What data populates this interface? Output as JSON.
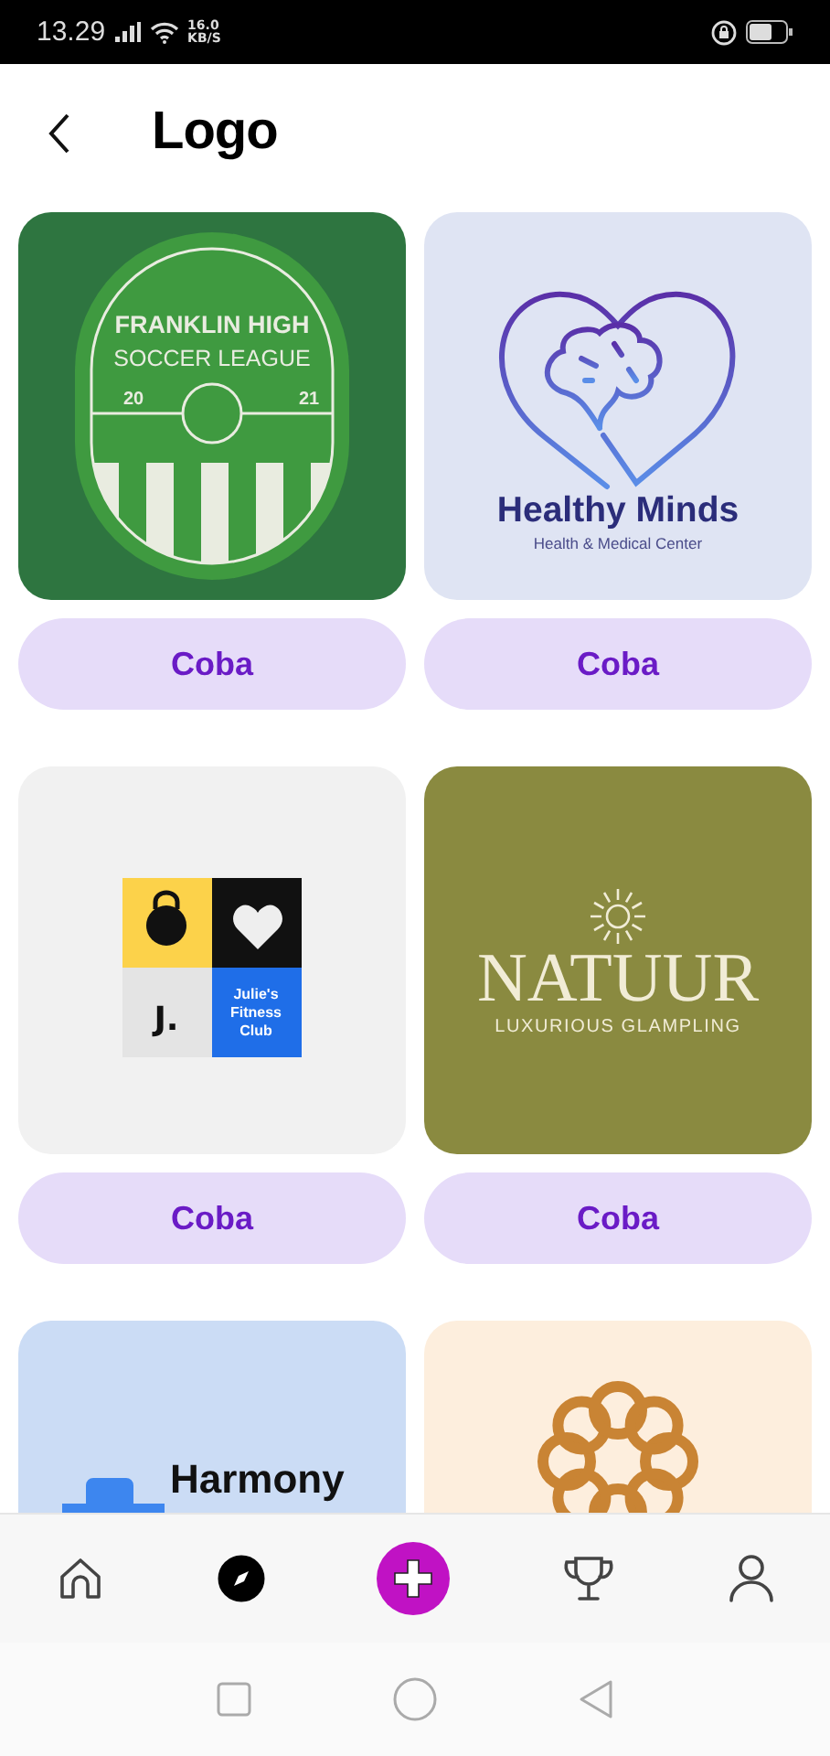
{
  "status_bar": {
    "time": "13.29",
    "speed": "16.0",
    "speed_unit": "KB/S"
  },
  "header": {
    "title": "Logo"
  },
  "templates": [
    {
      "kind": "soccer",
      "texts": [
        "FRANKLIN HIGH",
        "SOCCER LEAGUE",
        "20",
        "21"
      ],
      "button": "Coba"
    },
    {
      "kind": "minds",
      "texts": [
        "Healthy Minds",
        "Health & Medical Center"
      ],
      "button": "Coba"
    },
    {
      "kind": "fitness",
      "texts": [
        "J.",
        "Julie's",
        "Fitness",
        "Club"
      ],
      "button": "Coba"
    },
    {
      "kind": "natuur",
      "texts": [
        "NATUUR",
        "LUXURIOUS GLAMPLING"
      ],
      "button": "Coba"
    },
    {
      "kind": "harmony",
      "texts": [
        "Harmony"
      ]
    },
    {
      "kind": "knot"
    }
  ],
  "bottom_nav": [
    {
      "kind": "home",
      "selected": false
    },
    {
      "kind": "explore",
      "selected": true
    },
    {
      "kind": "create",
      "selected": false
    },
    {
      "kind": "trophy",
      "selected": false
    },
    {
      "kind": "profile",
      "selected": false
    }
  ]
}
